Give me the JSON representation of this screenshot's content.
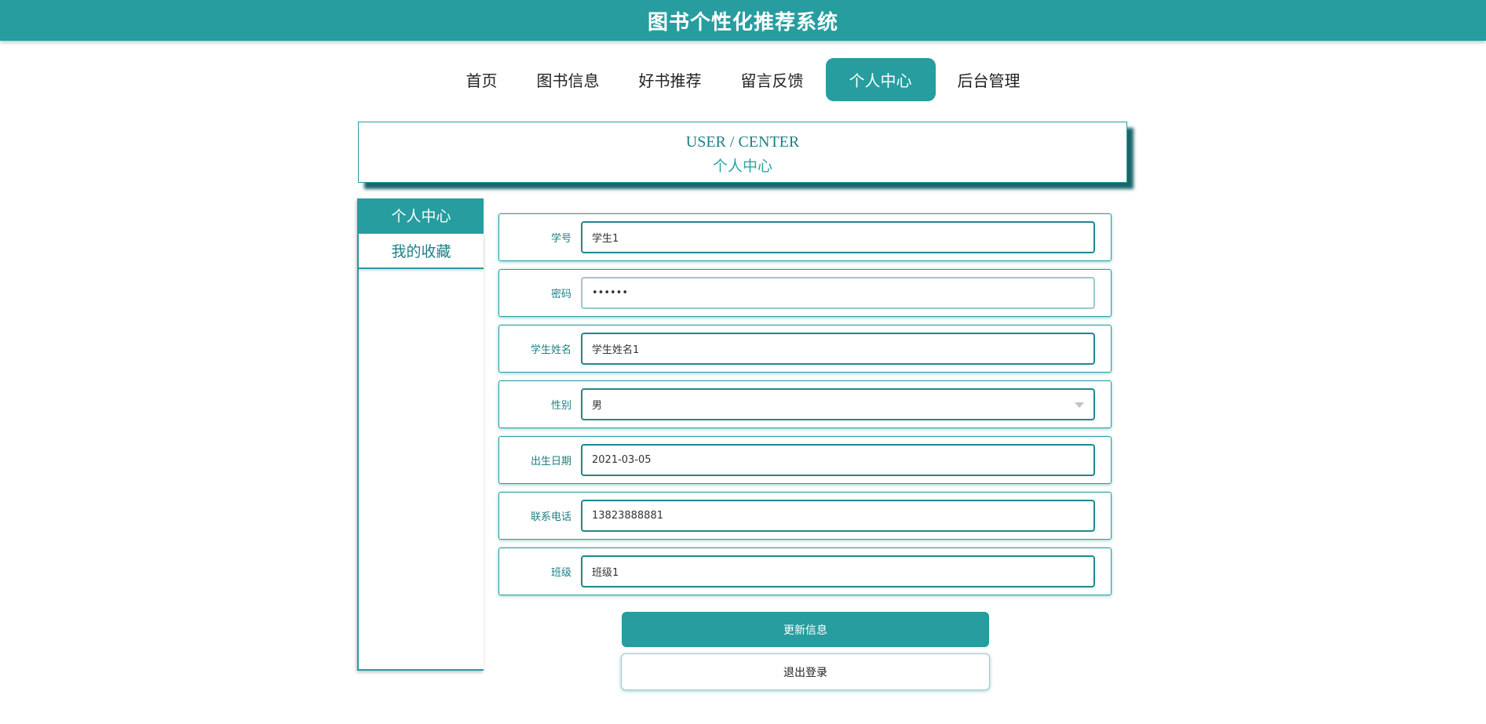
{
  "header": {
    "title": "图书个性化推荐系统"
  },
  "nav": {
    "items": [
      {
        "label": "首页"
      },
      {
        "label": "图书信息"
      },
      {
        "label": "好书推荐"
      },
      {
        "label": "留言反馈"
      },
      {
        "label": "个人中心",
        "active": true
      },
      {
        "label": "后台管理"
      }
    ]
  },
  "banner": {
    "en": "USER / CENTER",
    "cn": "个人中心"
  },
  "sidebar": {
    "items": [
      {
        "label": "个人中心",
        "active": true
      },
      {
        "label": "我的收藏"
      }
    ]
  },
  "form": {
    "fields": [
      {
        "label": "学号",
        "value": "学生1"
      },
      {
        "label": "密码",
        "value": "••••••"
      },
      {
        "label": "学生姓名",
        "value": "学生姓名1"
      },
      {
        "label": "性别",
        "value": "男"
      },
      {
        "label": "出生日期",
        "value": "2021-03-05"
      },
      {
        "label": "联系电话",
        "value": "13823888881"
      },
      {
        "label": "班级",
        "value": "班级1"
      }
    ]
  },
  "buttons": {
    "update": "更新信息",
    "logout": "退出登录"
  },
  "colors": {
    "accent": "#279d9f",
    "accent_dark": "#1e7f86"
  }
}
